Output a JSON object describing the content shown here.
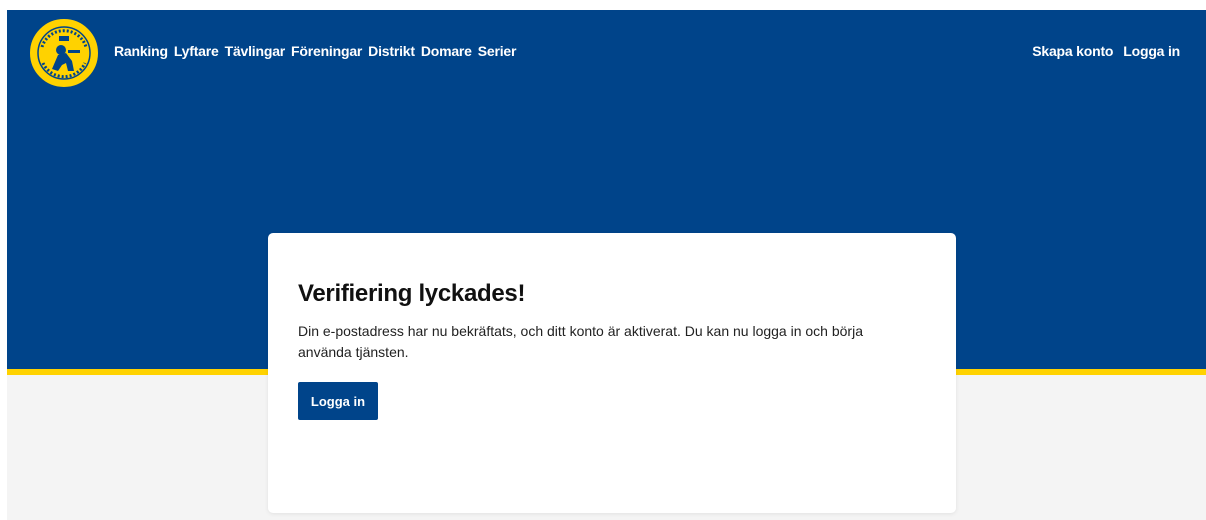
{
  "header": {
    "logo_icon": "federation-emblem-icon",
    "nav": [
      {
        "label": "Ranking"
      },
      {
        "label": "Lyftare"
      },
      {
        "label": "Tävlingar"
      },
      {
        "label": "Föreningar"
      },
      {
        "label": "Distrikt"
      },
      {
        "label": "Domare"
      },
      {
        "label": "Serier"
      }
    ],
    "account": {
      "register_label": "Skapa konto",
      "login_label": "Logga in"
    }
  },
  "card": {
    "title": "Verifiering lyckades!",
    "message": "Din e-postadress har nu bekräftats, och ditt konto är aktiverat. Du kan nu logga in och börja använda tjänsten.",
    "button_label": "Logga in"
  },
  "colors": {
    "brand_blue": "#00448a",
    "accent_yellow": "#ffd200",
    "background_grey": "#f4f4f4"
  }
}
